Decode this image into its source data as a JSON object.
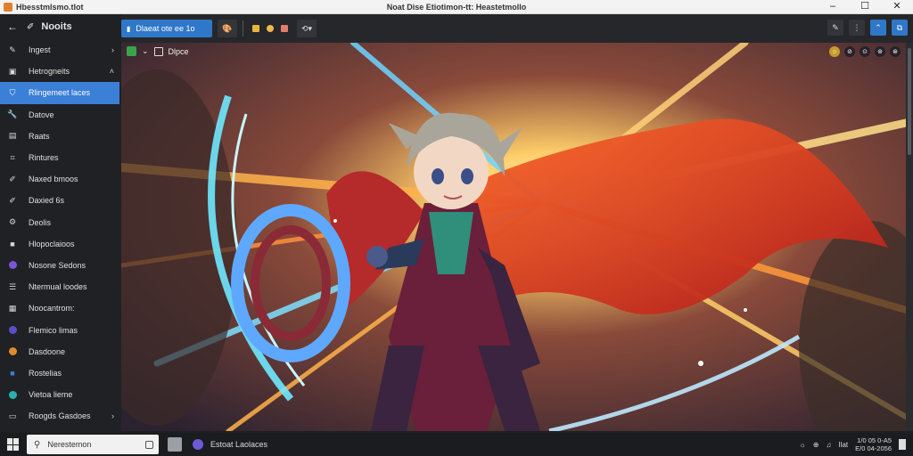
{
  "window": {
    "left_title": "Hbesstmlsmo.tlot",
    "center_title": "Noat Dise Etiotimon-tt: Heastetmollo",
    "controls": [
      "–",
      "☐",
      "✕"
    ]
  },
  "sidebar": {
    "back_icon": "arrow-left-icon",
    "header_icon": "brush-icon",
    "header_title": "Nooits",
    "items": [
      {
        "label": "Ingest",
        "icon": "pen-icon",
        "chevron": "›",
        "active": false
      },
      {
        "label": "Hetrogneits",
        "icon": "image-icon",
        "chevron": "˄",
        "active": false
      },
      {
        "label": "Rlingemeet laces",
        "icon": "shield-icon",
        "chevron": "",
        "active": true
      },
      {
        "label": "Datove",
        "icon": "wrench-icon",
        "chevron": "",
        "active": false
      },
      {
        "label": "Raats",
        "icon": "file-icon",
        "chevron": "",
        "active": false
      },
      {
        "label": "Rintures",
        "icon": "tag-icon",
        "chevron": "",
        "active": false
      },
      {
        "label": "Naxed bmoos",
        "icon": "edit-icon",
        "chevron": "",
        "active": false
      },
      {
        "label": "Daxied 6s",
        "icon": "edit-icon",
        "chevron": "",
        "active": false
      },
      {
        "label": "Deolis",
        "icon": "gear-icon",
        "chevron": "",
        "active": false
      },
      {
        "label": "Hlopoclaioos",
        "icon": "app-icon",
        "chevron": "",
        "active": false
      },
      {
        "label": "Nosone Sedons",
        "icon": "purple-circle-icon",
        "chevron": "",
        "active": false
      },
      {
        "label": "Ntermual loodes",
        "icon": "list-icon",
        "chevron": "",
        "active": false
      },
      {
        "label": "Noocantrom:",
        "icon": "note-icon",
        "chevron": "",
        "active": false
      },
      {
        "label": "Flemico limas",
        "icon": "violet-circle-icon",
        "chevron": "",
        "active": false
      },
      {
        "label": "Dasdoone",
        "icon": "orange-circle-icon",
        "chevron": "",
        "active": false
      },
      {
        "label": "Rostelias",
        "icon": "blue-square-icon",
        "chevron": "",
        "active": false
      },
      {
        "label": "Vietoa lieme",
        "icon": "teal-circle-icon",
        "chevron": "",
        "active": false
      },
      {
        "label": "Roogds Gasdoes",
        "icon": "folder-icon",
        "chevron": "›",
        "active": false
      }
    ]
  },
  "toolbar": {
    "primary_tab": "Dlaeat ote ee 1o",
    "tool_icons": [
      "palette-icon",
      "yellow-swatch-icon",
      "orange-swatch-icon",
      "pink-swatch-icon",
      "lasso-icon"
    ],
    "right_icons": [
      "✎",
      "⋮",
      "⌃",
      "⧉"
    ]
  },
  "viewer": {
    "badge_label": "Dlpce",
    "corner_icons": [
      "☺",
      "⊘",
      "⊙",
      "⊚",
      "⊛"
    ]
  },
  "taskbar": {
    "search_placeholder": "Nerestemon",
    "running_app_label": "Estoat Laolaces",
    "tray_icons": [
      "☼",
      "⊕",
      "♫",
      "Ilat"
    ],
    "clock_time": "1/0 05 0-A5",
    "clock_date": "E/0 04-2056"
  },
  "colors": {
    "accent": "#3b7fd6",
    "sidebar_bg": "#202124",
    "toolbar_bg": "#26272b",
    "green": "#3aa34a"
  }
}
